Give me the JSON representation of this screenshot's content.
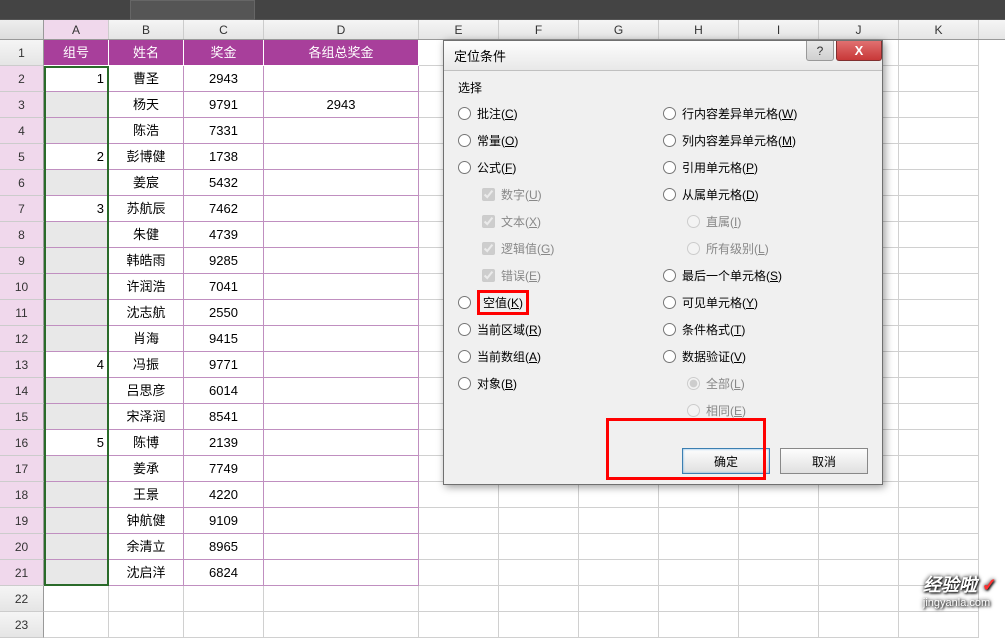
{
  "columns": [
    "A",
    "B",
    "C",
    "D",
    "E",
    "F",
    "G",
    "H",
    "I",
    "J",
    "K"
  ],
  "headers": {
    "A": "组号",
    "B": "姓名",
    "C": "奖金",
    "D": "各组总奖金"
  },
  "rows": [
    {
      "r": 1
    },
    {
      "r": 2,
      "A": "1",
      "B": "曹圣",
      "C": "2943"
    },
    {
      "r": 3,
      "B": "杨天",
      "C": "9791",
      "D": "2943"
    },
    {
      "r": 4,
      "B": "陈浩",
      "C": "7331"
    },
    {
      "r": 5,
      "A": "2",
      "B": "彭博健",
      "C": "1738"
    },
    {
      "r": 6,
      "B": "姜宸",
      "C": "5432"
    },
    {
      "r": 7,
      "A": "3",
      "B": "苏航辰",
      "C": "7462"
    },
    {
      "r": 8,
      "B": "朱健",
      "C": "4739"
    },
    {
      "r": 9,
      "B": "韩皓雨",
      "C": "9285"
    },
    {
      "r": 10,
      "B": "许润浩",
      "C": "7041"
    },
    {
      "r": 11,
      "B": "沈志航",
      "C": "2550"
    },
    {
      "r": 12,
      "B": "肖海",
      "C": "9415"
    },
    {
      "r": 13,
      "A": "4",
      "B": "冯振",
      "C": "9771"
    },
    {
      "r": 14,
      "B": "吕思彦",
      "C": "6014"
    },
    {
      "r": 15,
      "B": "宋泽润",
      "C": "8541"
    },
    {
      "r": 16,
      "A": "5",
      "B": "陈博",
      "C": "2139"
    },
    {
      "r": 17,
      "B": "姜承",
      "C": "7749"
    },
    {
      "r": 18,
      "B": "王景",
      "C": "4220"
    },
    {
      "r": 19,
      "B": "钟航健",
      "C": "9109"
    },
    {
      "r": 20,
      "B": "余清立",
      "C": "8965"
    },
    {
      "r": 21,
      "B": "沈启洋",
      "C": "6824"
    },
    {
      "r": 22
    },
    {
      "r": 23
    }
  ],
  "dialog": {
    "title": "定位条件",
    "group_label": "选择",
    "left_opts": [
      {
        "key": "comments",
        "label": "批注(C)",
        "type": "radio"
      },
      {
        "key": "constants",
        "label": "常量(O)",
        "type": "radio"
      },
      {
        "key": "formulas",
        "label": "公式(F)",
        "type": "radio"
      },
      {
        "key": "numbers",
        "label": "数字(U)",
        "type": "checkbox",
        "indent": 1,
        "disabled": true,
        "checked": true
      },
      {
        "key": "text",
        "label": "文本(X)",
        "type": "checkbox",
        "indent": 1,
        "disabled": true,
        "checked": true
      },
      {
        "key": "logicals",
        "label": "逻辑值(G)",
        "type": "checkbox",
        "indent": 1,
        "disabled": true,
        "checked": true
      },
      {
        "key": "errors",
        "label": "错误(E)",
        "type": "checkbox",
        "indent": 1,
        "disabled": true,
        "checked": true
      },
      {
        "key": "blanks",
        "label": "空值(K)",
        "type": "radio",
        "checked": true,
        "highlight": true
      },
      {
        "key": "current_region",
        "label": "当前区域(R)",
        "type": "radio"
      },
      {
        "key": "current_array",
        "label": "当前数组(A)",
        "type": "radio"
      },
      {
        "key": "objects",
        "label": "对象(B)",
        "type": "radio"
      }
    ],
    "right_opts": [
      {
        "key": "row_diff",
        "label": "行内容差异单元格(W)",
        "type": "radio"
      },
      {
        "key": "col_diff",
        "label": "列内容差异单元格(M)",
        "type": "radio"
      },
      {
        "key": "precedents",
        "label": "引用单元格(P)",
        "type": "radio"
      },
      {
        "key": "dependents",
        "label": "从属单元格(D)",
        "type": "radio"
      },
      {
        "key": "direct",
        "label": "直属(I)",
        "type": "radio",
        "indent": 1,
        "disabled": true,
        "checked": true
      },
      {
        "key": "all_levels",
        "label": "所有级别(L)",
        "type": "radio",
        "indent": 1,
        "disabled": true
      },
      {
        "key": "last_cell",
        "label": "最后一个单元格(S)",
        "type": "radio"
      },
      {
        "key": "visible",
        "label": "可见单元格(Y)",
        "type": "radio"
      },
      {
        "key": "cond_fmt",
        "label": "条件格式(T)",
        "type": "radio"
      },
      {
        "key": "data_val",
        "label": "数据验证(V)",
        "type": "radio"
      },
      {
        "key": "all",
        "label": "全部(L)",
        "type": "radio",
        "indent": 1,
        "disabled": true,
        "checked": true
      },
      {
        "key": "same",
        "label": "相同(E)",
        "type": "radio",
        "indent": 1,
        "disabled": true
      }
    ],
    "ok": "确定",
    "cancel": "取消",
    "help": "?",
    "close": "X"
  },
  "watermark": {
    "main": "经验啦",
    "check": "✓",
    "sub": "jingyanla.com"
  }
}
